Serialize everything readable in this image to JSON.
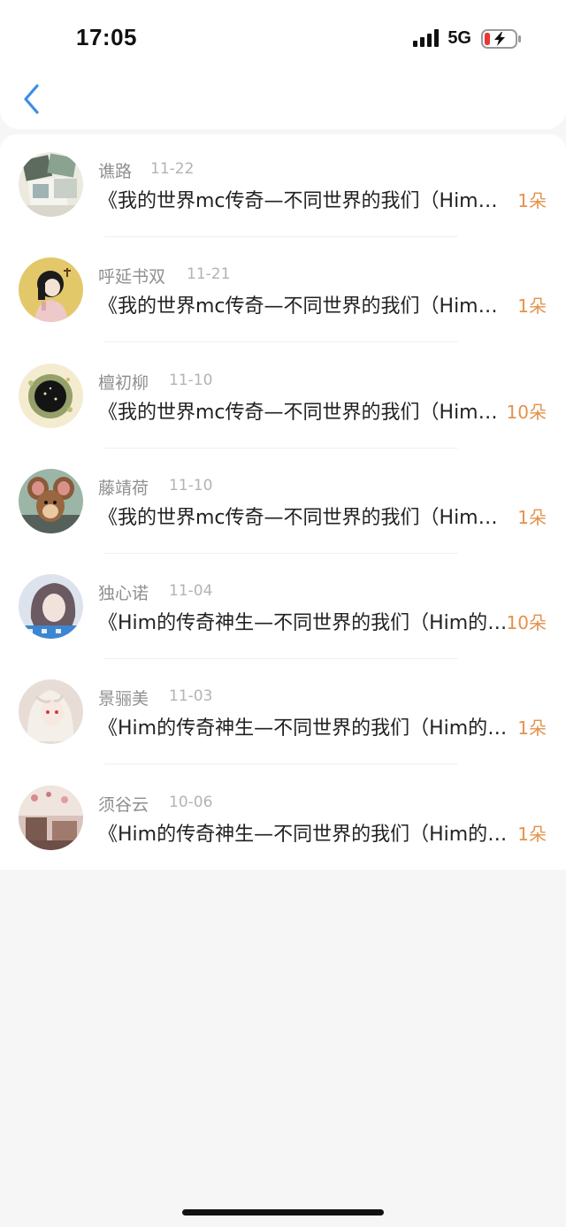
{
  "status_bar": {
    "time": "17:05",
    "network": "5G"
  },
  "colors": {
    "accent": "#3a8ee6",
    "count": "#e3924b",
    "background": "#f6f6f6"
  },
  "icons": {
    "back": "chevron-left-icon",
    "signal": "signal-icon",
    "battery": "battery-charging-icon"
  },
  "gifts": [
    {
      "name": "谯路",
      "date": "11-22",
      "title": "《我的世界mc传奇—不同世界的我们（Him的传奇神生）》",
      "count": "1朵"
    },
    {
      "name": "呼延书双",
      "date": "11-21",
      "title": "《我的世界mc传奇—不同世界的我们（Him的传奇神生）》",
      "count": "1朵"
    },
    {
      "name": "檀初柳",
      "date": "11-10",
      "title": "《我的世界mc传奇—不同世界的我们（Him的传奇神生）》",
      "count": "10朵"
    },
    {
      "name": "藤靖荷",
      "date": "11-10",
      "title": "《我的世界mc传奇—不同世界的我们（Him的传奇神生）》",
      "count": "1朵"
    },
    {
      "name": "独心诺",
      "date": "11-04",
      "title": "《Him的传奇神生—不同世界的我们（Him的传奇神生）》",
      "count": "10朵"
    },
    {
      "name": "景骊美",
      "date": "11-03",
      "title": "《Him的传奇神生—不同世界的我们（Him的传奇神生）》",
      "count": "1朵"
    },
    {
      "name": "须谷云",
      "date": "10-06",
      "title": "《Him的传奇神生—不同世界的我们（Him的传奇神生）》",
      "count": "1朵"
    }
  ]
}
